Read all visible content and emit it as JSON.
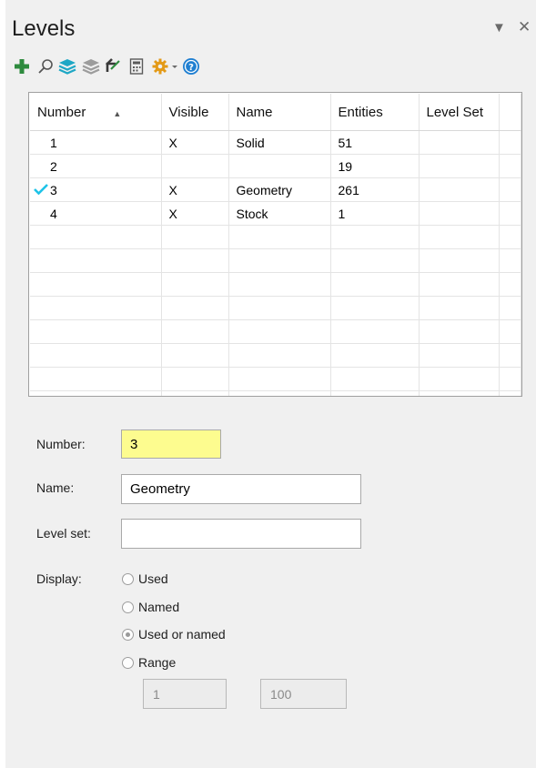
{
  "panel": {
    "title": "Levels",
    "dropdown_icon": "chevron-down-icon",
    "close_icon": "close-icon"
  },
  "toolbar": {
    "icons": [
      "add-level-icon",
      "search-icon",
      "layers-icon",
      "layers-gray-icon",
      "undo-icon",
      "calculator-icon",
      "gear-icon",
      "help-icon"
    ]
  },
  "grid": {
    "columns": [
      "Number",
      "Visible",
      "Name",
      "Entities",
      "Level Set"
    ],
    "rows": [
      {
        "number": "1",
        "visible": "X",
        "name": "Solid",
        "entities": "51",
        "level_set": "",
        "current": false
      },
      {
        "number": "2",
        "visible": "",
        "name": "",
        "entities": "19",
        "level_set": "",
        "current": false
      },
      {
        "number": "3",
        "visible": "X",
        "name": "Geometry",
        "entities": "261",
        "level_set": "",
        "current": true
      },
      {
        "number": "4",
        "visible": "X",
        "name": "Stock",
        "entities": "1",
        "level_set": "",
        "current": false
      }
    ]
  },
  "form": {
    "number_label": "Number:",
    "number_value": "3",
    "name_label": "Name:",
    "name_value": "Geometry",
    "level_set_label": "Level set:",
    "level_set_value": "",
    "display_label": "Display:",
    "display_options": [
      "Used",
      "Named",
      "Used or named",
      "Range"
    ],
    "display_selected": "Used or named",
    "range_from": "1",
    "range_to": "100"
  },
  "colors": {
    "add_icon": "#2e8b3e",
    "layers_icon": "#1ea7c5",
    "check_mark": "#1ec3e8",
    "number_highlight": "#fdfc8f",
    "gear_icon": "#e39a17",
    "help_icon": "#1f7fd1"
  }
}
